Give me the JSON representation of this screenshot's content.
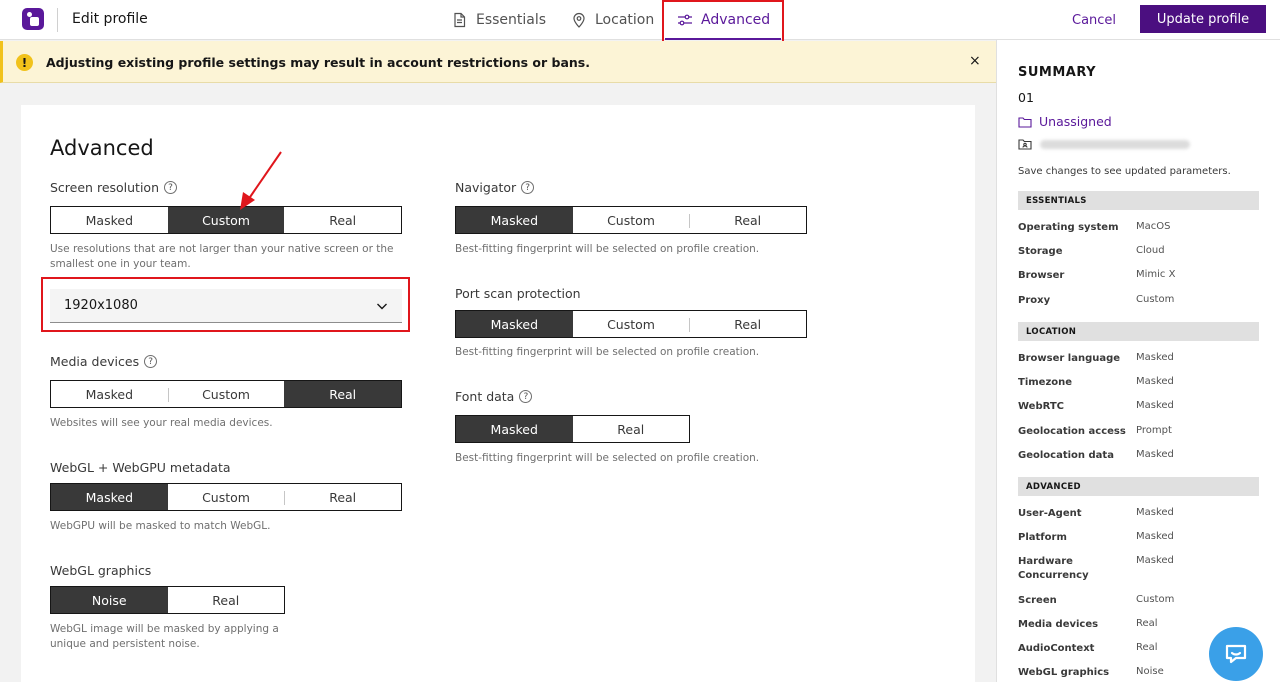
{
  "header": {
    "title": "Edit profile",
    "tabs": [
      {
        "label": "Essentials",
        "icon": "document-icon"
      },
      {
        "label": "Location",
        "icon": "location-pin-icon"
      },
      {
        "label": "Advanced",
        "icon": "sliders-icon",
        "active": true
      }
    ],
    "cancel_label": "Cancel",
    "update_label": "Update profile"
  },
  "banner": {
    "text": "Adjusting existing profile settings may result in account restrictions or bans.",
    "icon": "warning-icon",
    "close": "×"
  },
  "main": {
    "title": "Advanced",
    "settings": {
      "screen_resolution": {
        "label": "Screen resolution",
        "options": [
          "Masked",
          "Custom",
          "Real"
        ],
        "selected": "Custom",
        "hint_line1": "Use resolutions that are not larger than your native screen or the",
        "hint_line2": "smallest one in your team.",
        "select_value": "1920x1080"
      },
      "media_devices": {
        "label": "Media devices",
        "options": [
          "Masked",
          "Custom",
          "Real"
        ],
        "selected": "Real",
        "hint": "Websites will see your real media devices."
      },
      "webgl_metadata": {
        "label": "WebGL + WebGPU metadata",
        "options": [
          "Masked",
          "Custom",
          "Real"
        ],
        "selected": "Masked",
        "hint": "WebGPU will be masked to match WebGL."
      },
      "webgl_graphics": {
        "label": "WebGL graphics",
        "options": [
          "Noise",
          "Real"
        ],
        "selected": "Noise",
        "hint_line1": "WebGL image will be masked by applying a",
        "hint_line2": "unique and persistent noise."
      },
      "navigator": {
        "label": "Navigator",
        "options": [
          "Masked",
          "Custom",
          "Real"
        ],
        "selected": "Masked",
        "hint": "Best-fitting fingerprint will be selected on profile creation."
      },
      "port_scan": {
        "label": "Port scan protection",
        "options": [
          "Masked",
          "Custom",
          "Real"
        ],
        "selected": "Masked",
        "hint": "Best-fitting fingerprint will be selected on profile creation."
      },
      "font_data": {
        "label": "Font data",
        "options": [
          "Masked",
          "Real"
        ],
        "selected": "Masked",
        "hint": "Best-fitting fingerprint will be selected on profile creation."
      }
    }
  },
  "summary": {
    "title": "SUMMARY",
    "number": "01",
    "folder": "Unassigned",
    "note": "Save changes to see updated parameters.",
    "essentials_head": "ESSENTIALS",
    "essentials": [
      {
        "key": "Operating system",
        "value": "MacOS"
      },
      {
        "key": "Storage",
        "value": "Cloud"
      },
      {
        "key": "Browser",
        "value": "Mimic X"
      },
      {
        "key": "Proxy",
        "value": "Custom"
      }
    ],
    "location_head": "LOCATION",
    "location": [
      {
        "key": "Browser language",
        "value": "Masked"
      },
      {
        "key": "Timezone",
        "value": "Masked"
      },
      {
        "key": "WebRTC",
        "value": "Masked"
      },
      {
        "key": "Geolocation access",
        "value": "Prompt"
      },
      {
        "key": "Geolocation data",
        "value": "Masked"
      }
    ],
    "advanced_head": "ADVANCED",
    "advanced": [
      {
        "key": "User-Agent",
        "value": "Masked"
      },
      {
        "key": "Platform",
        "value": "Masked"
      },
      {
        "key": "Hardware Concurrency",
        "value": "Masked"
      },
      {
        "key": "Screen",
        "value": "Custom"
      },
      {
        "key": "Media devices",
        "value": "Real"
      },
      {
        "key": "AudioContext",
        "value": "Real"
      },
      {
        "key": "WebGL graphics",
        "value": "Noise"
      }
    ]
  },
  "colors": {
    "brand": "#5a189a",
    "annotation": "#e0161c",
    "warning": "#f1c21b",
    "chat": "#3aa0e8"
  }
}
